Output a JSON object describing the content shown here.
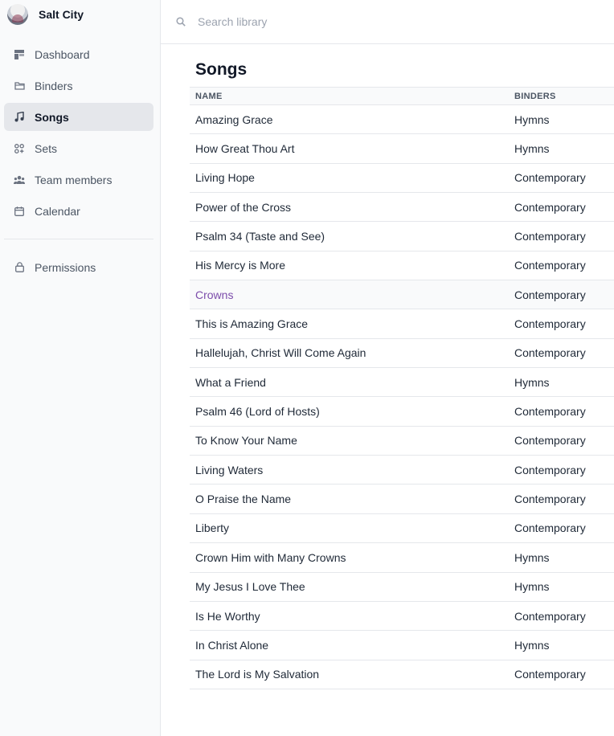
{
  "brand": {
    "name": "Salt City"
  },
  "nav": {
    "items": [
      {
        "label": "Dashboard",
        "icon": "dashboard-icon"
      },
      {
        "label": "Binders",
        "icon": "folder-icon"
      },
      {
        "label": "Songs",
        "icon": "music-note-icon",
        "active": true
      },
      {
        "label": "Sets",
        "icon": "grid-icon"
      },
      {
        "label": "Team members",
        "icon": "team-icon"
      },
      {
        "label": "Calendar",
        "icon": "calendar-icon"
      }
    ],
    "secondary": [
      {
        "label": "Permissions",
        "icon": "lock-icon"
      }
    ]
  },
  "search": {
    "placeholder": "Search library",
    "value": ""
  },
  "main": {
    "title": "Songs",
    "columns": [
      "NAME",
      "BINDERS"
    ],
    "rows": [
      {
        "name": "Amazing Grace",
        "binder": "Hymns"
      },
      {
        "name": "How Great Thou Art",
        "binder": "Hymns"
      },
      {
        "name": "Living Hope",
        "binder": "Contemporary"
      },
      {
        "name": "Power of the Cross",
        "binder": "Contemporary"
      },
      {
        "name": "Psalm 34 (Taste and See)",
        "binder": "Contemporary"
      },
      {
        "name": "His Mercy is More",
        "binder": "Contemporary"
      },
      {
        "name": "Crowns",
        "binder": "Contemporary",
        "hovered": true
      },
      {
        "name": "This is Amazing Grace",
        "binder": "Contemporary"
      },
      {
        "name": "Hallelujah, Christ Will Come Again",
        "binder": "Contemporary"
      },
      {
        "name": "What a Friend",
        "binder": "Hymns"
      },
      {
        "name": "Psalm 46 (Lord of Hosts)",
        "binder": "Contemporary"
      },
      {
        "name": "To Know Your Name",
        "binder": "Contemporary"
      },
      {
        "name": "Living Waters",
        "binder": "Contemporary"
      },
      {
        "name": "O Praise the Name",
        "binder": "Contemporary"
      },
      {
        "name": "Liberty",
        "binder": "Contemporary"
      },
      {
        "name": "Crown Him with Many Crowns",
        "binder": "Hymns"
      },
      {
        "name": "My Jesus I Love Thee",
        "binder": "Hymns"
      },
      {
        "name": "Is He Worthy",
        "binder": "Contemporary"
      },
      {
        "name": "In Christ Alone",
        "binder": "Hymns"
      },
      {
        "name": "The Lord is My Salvation",
        "binder": "Contemporary"
      }
    ]
  },
  "colors": {
    "accent": "#7c4dab",
    "active_bg": "#e5e7eb",
    "sidebar_bg": "#f9fafb"
  }
}
